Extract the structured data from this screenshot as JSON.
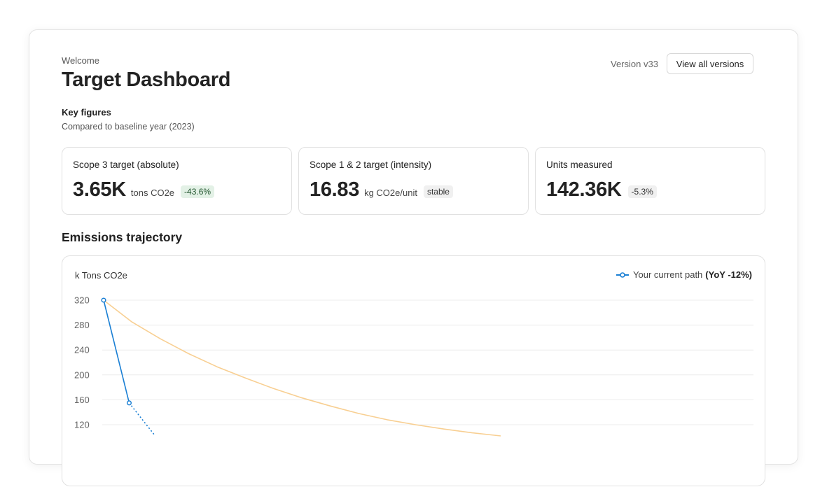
{
  "header": {
    "welcome": "Welcome",
    "title": "Target Dashboard",
    "version_label": "Version v33",
    "versions_button": "View all versions"
  },
  "key_figures": {
    "title": "Key figures",
    "subtitle": "Compared to baseline year (2023)",
    "cards": [
      {
        "label": "Scope 3 target (absolute)",
        "value": "3.65K",
        "unit": "tons CO2e",
        "badge": "-43.6%"
      },
      {
        "label": "Scope 1 & 2 target (intensity)",
        "value": "16.83",
        "unit": "kg CO2e/unit",
        "badge": "stable"
      },
      {
        "label": "Units measured",
        "value": "142.36K",
        "unit": "",
        "badge": "-5.3%"
      }
    ]
  },
  "trajectory": {
    "section_title": "Emissions trajectory",
    "legend_text": "Your current path",
    "legend_bold": "(YoY -12%)"
  },
  "colors": {
    "current_path": "#1a7fd4",
    "target_curve": "#f8cf92",
    "positive_badge_bg": "#e3f1e6",
    "neutral_badge_bg": "#f0f0f0"
  },
  "chart_data": {
    "type": "line",
    "ylabel": "k Tons CO2e",
    "yticks": [
      320,
      280,
      240,
      200,
      160,
      120
    ],
    "ylim": [
      103,
      320
    ],
    "grid": true,
    "legend_position": "top-right",
    "series": [
      {
        "name": "Your current path (YoY -12%)",
        "style": "solid-then-dotted",
        "points": [
          {
            "x": 0,
            "y": 320
          },
          {
            "x": 1,
            "y": 155
          },
          {
            "x": 2,
            "y": 103
          }
        ]
      },
      {
        "style": "solid",
        "points": [
          {
            "x": 0,
            "y": 320
          },
          {
            "x": 1,
            "y": 285
          },
          {
            "x": 2,
            "y": 258
          },
          {
            "x": 3,
            "y": 234
          },
          {
            "x": 4,
            "y": 213
          },
          {
            "x": 5,
            "y": 195
          },
          {
            "x": 6,
            "y": 178
          },
          {
            "x": 7,
            "y": 163
          },
          {
            "x": 8,
            "y": 150
          },
          {
            "x": 9,
            "y": 138
          },
          {
            "x": 10,
            "y": 128
          },
          {
            "x": 11,
            "y": 120
          },
          {
            "x": 12,
            "y": 113
          },
          {
            "x": 13,
            "y": 107
          },
          {
            "x": 14,
            "y": 102
          }
        ]
      }
    ]
  }
}
